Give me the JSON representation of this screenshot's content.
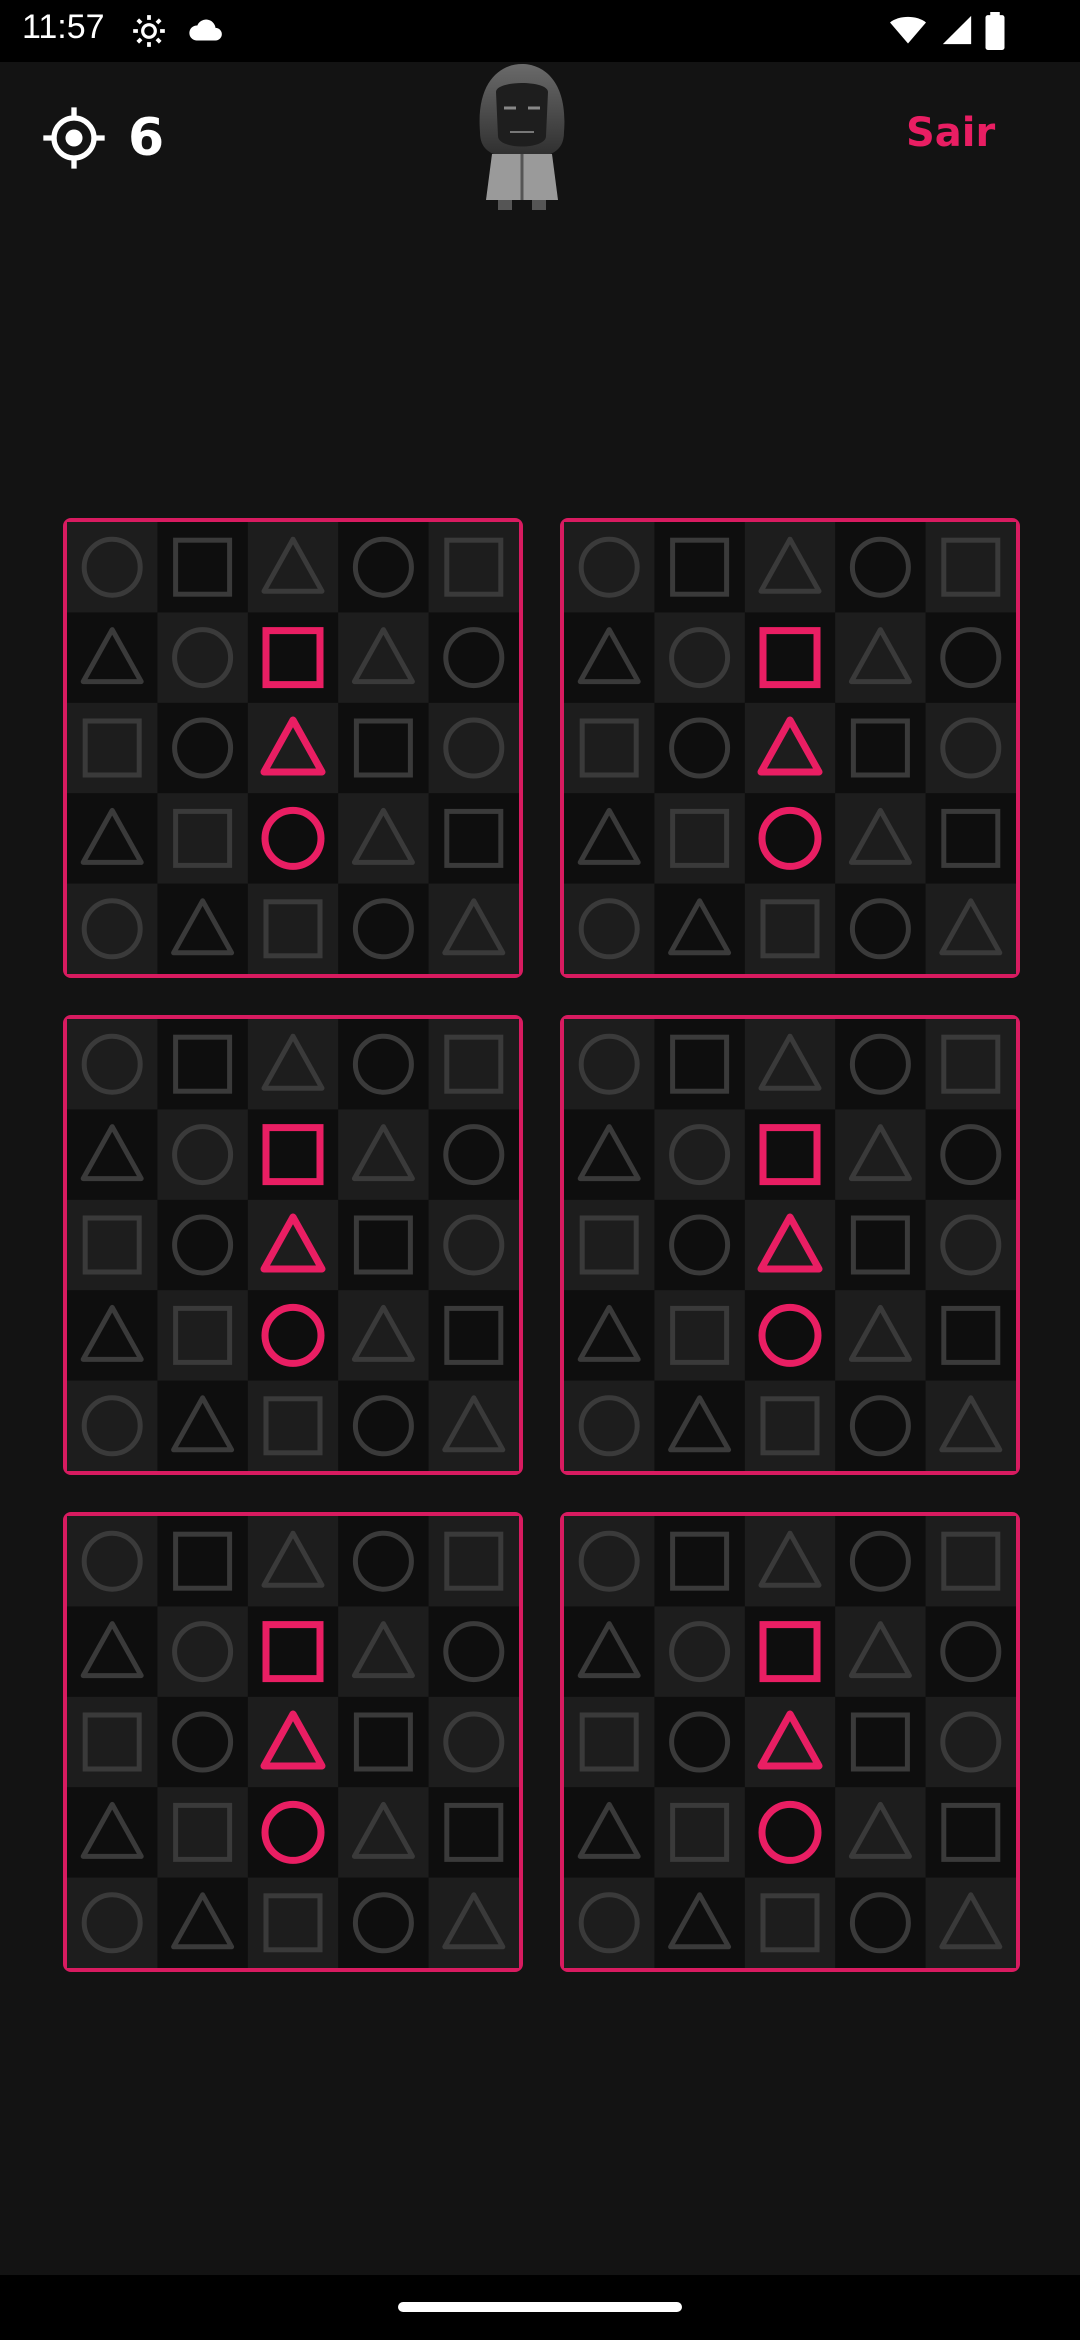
{
  "status_bar": {
    "time": "11:57",
    "icons": [
      "settings-gear-icon",
      "cloud-icon",
      "wifi-icon",
      "signal-icon",
      "battery-icon"
    ]
  },
  "header": {
    "score_icon": "crosshair-icon",
    "score": "6",
    "avatar": "masked-guard-avatar",
    "exit_label": "Sair"
  },
  "colors": {
    "accent": "#e91e63",
    "card_border": "#d81b60",
    "cell_dark": "#0e0e0e",
    "cell_light": "#1d1d1d",
    "shape_dim": "#3a3a3a"
  },
  "pattern": {
    "grid": [
      [
        "circle",
        "square",
        "triangle",
        "circle",
        "square"
      ],
      [
        "triangle",
        "circle",
        "square",
        "triangle",
        "circle"
      ],
      [
        "square",
        "circle",
        "triangle",
        "square",
        "circle"
      ],
      [
        "triangle",
        "square",
        "circle",
        "triangle",
        "square"
      ],
      [
        "circle",
        "triangle",
        "square",
        "circle",
        "triangle"
      ]
    ],
    "highlighted": [
      [
        1,
        2
      ],
      [
        2,
        2
      ],
      [
        3,
        2
      ]
    ]
  },
  "cards": [
    {
      "id": "card-1"
    },
    {
      "id": "card-2"
    },
    {
      "id": "card-3"
    },
    {
      "id": "card-4"
    },
    {
      "id": "card-5"
    },
    {
      "id": "card-6"
    }
  ]
}
